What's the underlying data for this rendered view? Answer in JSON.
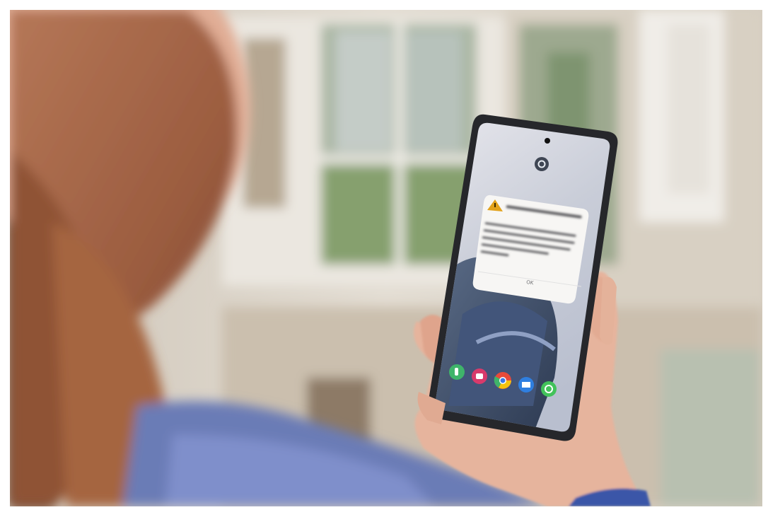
{
  "scene": {
    "description_free": true,
    "colors": {
      "wall": "#d9d2c6",
      "window_frame": "#ece8e1",
      "garden": "#7f9a6a",
      "hair": "#a86a4c",
      "sweater": "#6b7db8",
      "skin": "#e8b9a4",
      "phone_body": "#2a2b2f",
      "phone_screen": "#d6d9e2",
      "alert_card": "#f7f6f4",
      "warning_amber": "#e2a21c"
    }
  },
  "phone": {
    "status_icon": "assistant-circle-icon",
    "alert": {
      "icon": "warning-triangle-icon",
      "title": "",
      "body": "",
      "button": "OK"
    },
    "dock": [
      {
        "icon": "phone-app-icon",
        "color": "#3fb46a"
      },
      {
        "icon": "messages-app-icon",
        "color": "#d83a6b"
      },
      {
        "icon": "chrome-app-icon",
        "color": "#e84a3a"
      },
      {
        "icon": "email-app-icon",
        "color": "#2f7fe0"
      },
      {
        "icon": "whatsapp-app-icon",
        "color": "#42c25a"
      }
    ]
  }
}
